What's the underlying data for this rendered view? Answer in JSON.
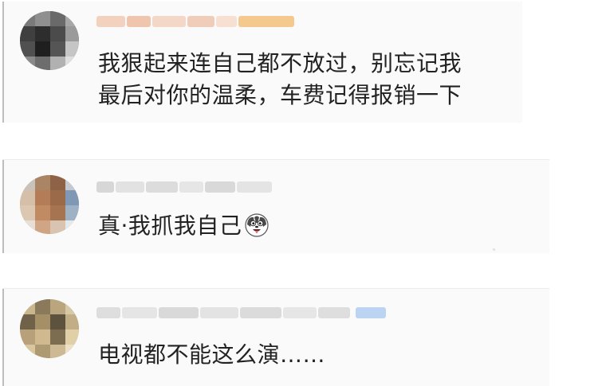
{
  "comments": [
    {
      "text_lines": [
        "我狠起来连自己都不放过，别忘记我",
        "最后对你的温柔，车费记得报销一下"
      ]
    },
    {
      "text": "真·我抓我自己",
      "emoji": "husky-laughing-icon"
    },
    {
      "text": "电视都不能这么演……"
    }
  ],
  "colors": {
    "text": "#222222",
    "card_background": "#fafafa",
    "card_edge": "#bdbdbd"
  }
}
